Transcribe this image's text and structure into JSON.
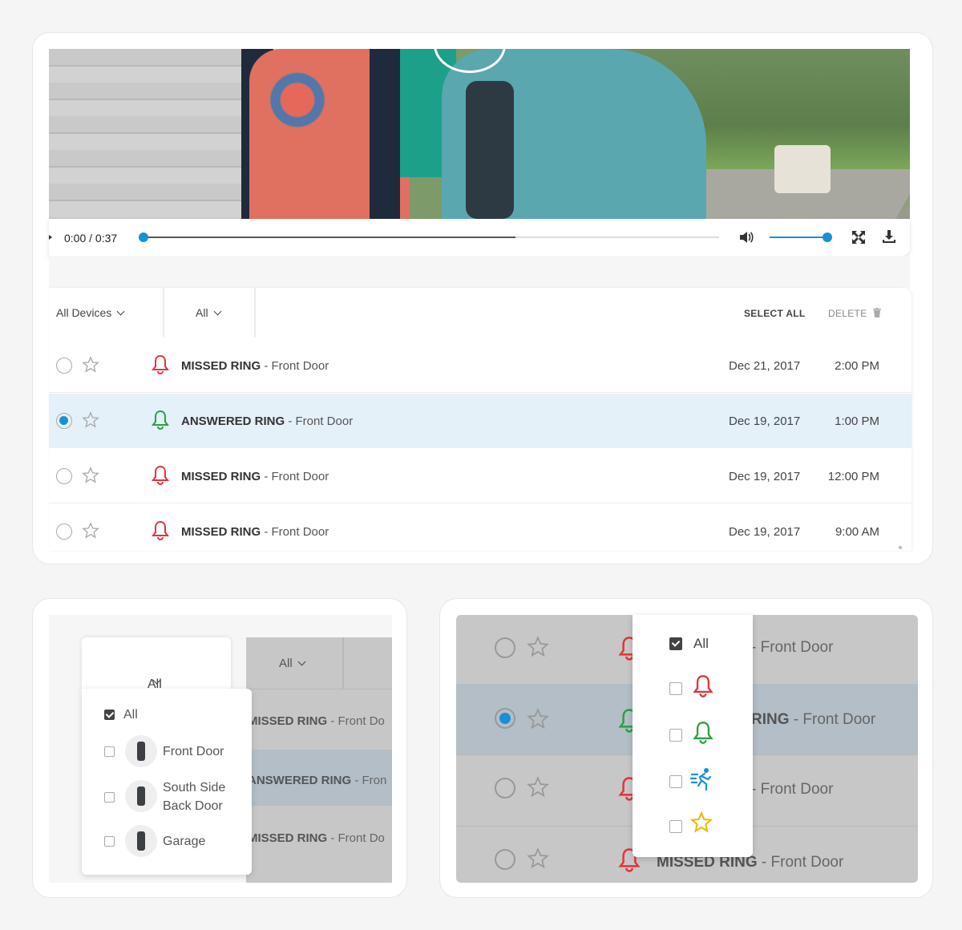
{
  "player": {
    "time": "0:00 / 0:37"
  },
  "filters": {
    "devices_label": "All Devices",
    "type_label": "All",
    "select_all": "SELECT ALL",
    "delete": "DELETE"
  },
  "events": [
    {
      "type": "MISSED RING",
      "device": " - Front Door",
      "date": "Dec 21, 2017",
      "time": "2:00 PM",
      "bell_color": "#e0343a",
      "selected": false
    },
    {
      "type": "ANSWERED RING",
      "device": " - Front Door",
      "date": "Dec 19, 2017",
      "time": "1:00 PM",
      "bell_color": "#2e9e44",
      "selected": true
    },
    {
      "type": "MISSED RING",
      "device": " - Front Door",
      "date": "Dec 19, 2017",
      "time": "12:00 PM",
      "bell_color": "#e0343a",
      "selected": false
    },
    {
      "type": "MISSED RING",
      "device": " - Front Door",
      "date": "Dec 19, 2017",
      "time": "9:00 AM",
      "bell_color": "#e0343a",
      "selected": false
    }
  ],
  "device_dropdown": {
    "header": "All Devices",
    "all_label": "All",
    "devices": [
      "Front Door",
      "South Side Back Door",
      "Garage"
    ]
  },
  "background_rows_left": [
    {
      "type": "MISSED RING",
      "device": " - Front Do"
    },
    {
      "type": "ANSWERED RING",
      "device": " - Fron"
    },
    {
      "type": "MISSED RING",
      "device": " - Front Do"
    }
  ],
  "type_dropdown": {
    "all_label": "All",
    "options": [
      "missed-ring-icon",
      "answered-ring-icon",
      "motion-icon",
      "favorite-star-icon"
    ]
  },
  "background_rows_right": [
    {
      "fragment": "- Front Door"
    },
    {
      "fragment": "RING",
      "device": " - Front Door"
    },
    {
      "fragment": "- Front Door"
    },
    {
      "type": "MISSED RING",
      "device": " - Front Door"
    }
  ],
  "colors": {
    "accent": "#1a8fd3",
    "missed": "#e0343a",
    "answered": "#2e9e44",
    "motion": "#1a8fd3",
    "favorite": "#f2b705",
    "selected_row": "#e4f1f9"
  }
}
